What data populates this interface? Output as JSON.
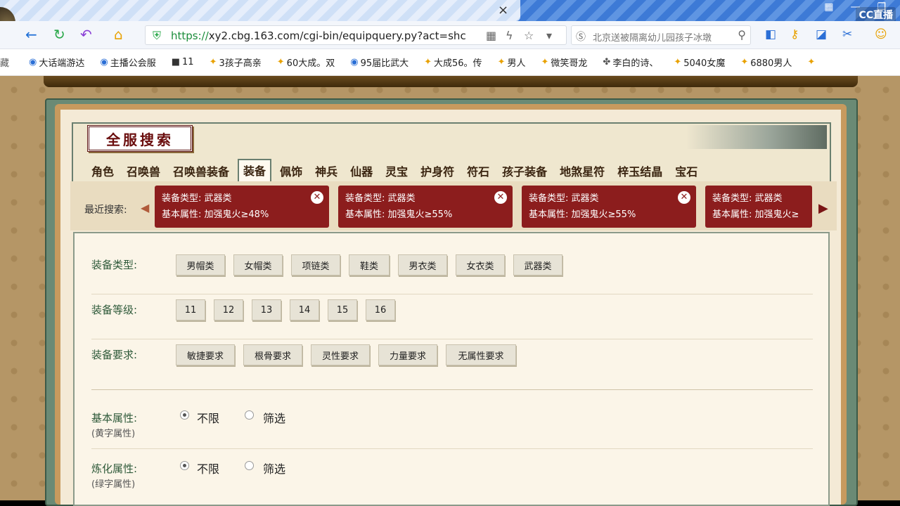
{
  "browser": {
    "tab_close": "×",
    "url_scheme": "https://",
    "url_rest": "xy2.cbg.163.com/cgi-bin/equipquery.py?act=shc",
    "search_text": "北京送被隔离幼儿园孩子冰墩",
    "cc_logo": "CC直播",
    "bookmarks": [
      {
        "label": "大话端游达",
        "icon": "blue"
      },
      {
        "label": "主播公会服",
        "icon": "blue"
      },
      {
        "label": "11",
        "icon": "dark"
      },
      {
        "label": "3孩子高亲",
        "icon": "gold"
      },
      {
        "label": "60大成。双",
        "icon": "gold"
      },
      {
        "label": "95届比武大",
        "icon": "blue"
      },
      {
        "label": "大成56。传",
        "icon": "gold"
      },
      {
        "label": "男人",
        "icon": "gold"
      },
      {
        "label": "微笑哥龙",
        "icon": "gold"
      },
      {
        "label": "李白的诗、",
        "icon": "dark"
      },
      {
        "label": "5040女魔",
        "icon": "gold"
      },
      {
        "label": "6880男人",
        "icon": "gold"
      }
    ]
  },
  "page": {
    "title": "全服搜索",
    "tabs": [
      "角色",
      "召唤兽",
      "召唤兽装备",
      "装备",
      "佩饰",
      "神兵",
      "仙器",
      "灵宝",
      "护身符",
      "符石",
      "孩子装备",
      "地煞星符",
      "梓玉结晶",
      "宝石"
    ],
    "active_tab": "装备",
    "recent_label": "最近搜索:",
    "recent": [
      {
        "line1": "装备类型: 武器类",
        "line2": "基本属性: 加强鬼火≥48%"
      },
      {
        "line1": "装备类型: 武器类",
        "line2": "基本属性: 加强鬼火≥55%"
      },
      {
        "line1": "装备类型: 武器类",
        "line2": "基本属性: 加强鬼火≥55%"
      },
      {
        "line1": "装备类型: 武器类",
        "line2": "基本属性: 加强鬼火≥"
      }
    ],
    "filters": {
      "type_label": "装备类型:",
      "types": [
        "男帽类",
        "女帽类",
        "项链类",
        "鞋类",
        "男衣类",
        "女衣类",
        "武器类"
      ],
      "level_label": "装备等级:",
      "levels": [
        "11",
        "12",
        "13",
        "14",
        "15",
        "16"
      ],
      "req_label": "装备要求:",
      "reqs": [
        "敏捷要求",
        "根骨要求",
        "灵性要求",
        "力量要求",
        "无属性要求"
      ],
      "basic_label": "基本属性:",
      "basic_sub": "(黄字属性)",
      "refine_label": "炼化属性:",
      "refine_sub": "(绿字属性)",
      "opt_unlimited": "不限",
      "opt_filter": "筛选"
    }
  }
}
